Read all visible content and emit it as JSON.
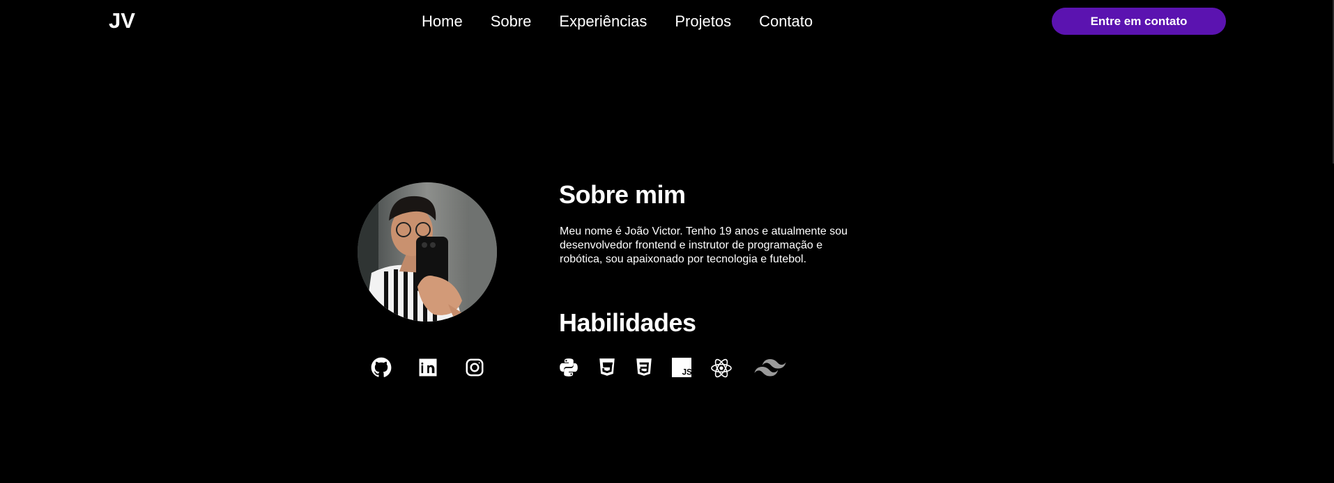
{
  "header": {
    "logo": "JV",
    "nav": [
      "Home",
      "Sobre",
      "Experiências",
      "Projetos",
      "Contato"
    ],
    "cta_label": "Entre em contato"
  },
  "about": {
    "title": "Sobre mim",
    "text": "Meu nome é João Victor. Tenho 19 anos e atualmente sou desenvolvedor frontend e instrutor de programação e robótica, sou apaixonado por tecnologia e futebol."
  },
  "skills": {
    "title": "Habilidades",
    "icons": [
      "python-icon",
      "html5-icon",
      "css3-icon",
      "javascript-icon",
      "react-icon",
      "tailwind-icon"
    ]
  },
  "social": {
    "icons": [
      "github-icon",
      "linkedin-icon",
      "instagram-icon"
    ]
  },
  "colors": {
    "background": "#000000",
    "accent": "#5b13b0",
    "text": "#ffffff"
  }
}
